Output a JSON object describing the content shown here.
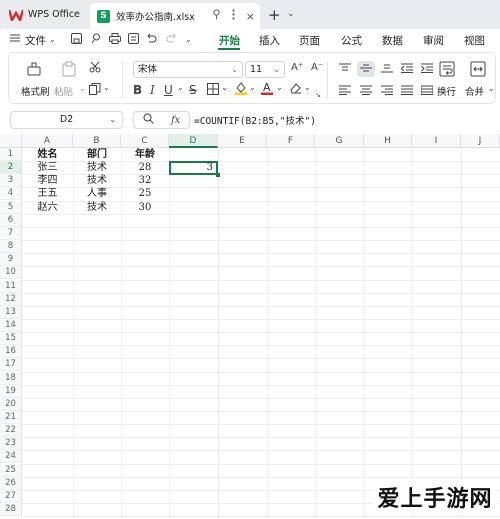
{
  "titlebar": {
    "app_tab": "WPS Office",
    "file_tab": "效率办公指南.xlsx"
  },
  "menu": {
    "file": "文件",
    "tabs": [
      "开始",
      "插入",
      "页面",
      "公式",
      "数据",
      "审阅",
      "视图"
    ],
    "active_tab": "开始"
  },
  "ribbon": {
    "format_painter": "格式刷",
    "paste": "粘贴",
    "font_name": "宋体",
    "font_size": "11",
    "wrap": "换行",
    "merge": "合并"
  },
  "formula_bar": {
    "cell_ref": "D2",
    "formula": "=COUNTIF(B2:B5,\"技术\")"
  },
  "sheet": {
    "columns": [
      "A",
      "B",
      "C",
      "D",
      "E",
      "F",
      "G",
      "H",
      "I",
      "J"
    ],
    "selected_column": "D",
    "row_numbers": [
      "1",
      "2",
      "3",
      "4",
      "5",
      "6",
      "7",
      "8",
      "9",
      "10",
      "11",
      "12",
      "13",
      "14",
      "15",
      "16",
      "17",
      "18",
      "19",
      "20",
      "21",
      "22",
      "23",
      "24",
      "25",
      "26",
      "27",
      "28"
    ],
    "headers": [
      "姓名",
      "部门",
      "年龄"
    ],
    "rows": [
      [
        "张三",
        "技术",
        "28"
      ],
      [
        "李四",
        "技术",
        "32"
      ],
      [
        "王五",
        "人事",
        "25"
      ],
      [
        "赵六",
        "技术",
        "30"
      ]
    ],
    "result_value": "3"
  },
  "watermark": "爱上手游网",
  "colors": {
    "accent": "#1a7b4a",
    "wps_red": "#d9282c",
    "sheet_green": "#0e9f61"
  }
}
